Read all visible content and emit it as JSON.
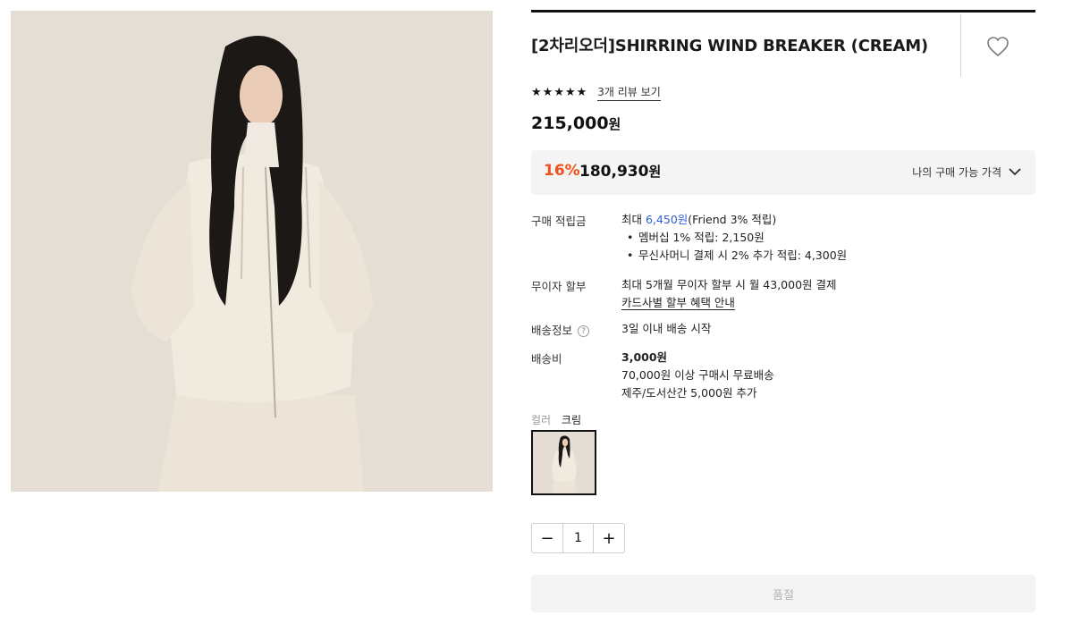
{
  "product": {
    "title": "[2차리오더]SHIRRING WIND BREAKER (CREAM)",
    "image_alt": "model wearing cream wind breaker"
  },
  "rating": {
    "stars": 5,
    "review_link": "3개 리뷰 보기"
  },
  "price": {
    "amount": "215,000",
    "unit": "원"
  },
  "discount": {
    "rate": "16%",
    "amount": "180,930",
    "unit": "원",
    "my_price_label": "나의 구매 가능 가격"
  },
  "points": {
    "label": "구매 적립금",
    "prefix": "최대 ",
    "max": "6,450원",
    "suffix": "(Friend 3% 적립)",
    "items": [
      "멤버십 1% 적립: 2,150원",
      "무신사머니 결제 시 2% 추가 적립: 4,300원"
    ]
  },
  "installment": {
    "label": "무이자 할부",
    "text": "최대 5개월 무이자 할부 시 월 43,000원 결제",
    "link": "카드사별 할부 혜택 안내"
  },
  "delivery": {
    "label": "배송정보",
    "help": "?",
    "text": "3일 이내 배송 시작"
  },
  "shipping_fee": {
    "label": "배송비",
    "amount": "3,000원",
    "free_condition": "70,000원 이상 구매시 무료배송",
    "extra": "제주/도서산간 5,000원 추가"
  },
  "color": {
    "label": "컬러",
    "value": "크림"
  },
  "quantity": {
    "value": "1",
    "minus": "−",
    "plus": "+"
  },
  "buy_button": {
    "label": "품절"
  },
  "icons": {
    "like": "heart-outline-icon",
    "dropdown": "chevron-down-icon",
    "help": "question-circle-icon",
    "star": "star-icon"
  },
  "colors": {
    "discount": "#f0521c",
    "points_highlight": "#2f5fd1",
    "panel_bg": "#f4f4f4"
  }
}
